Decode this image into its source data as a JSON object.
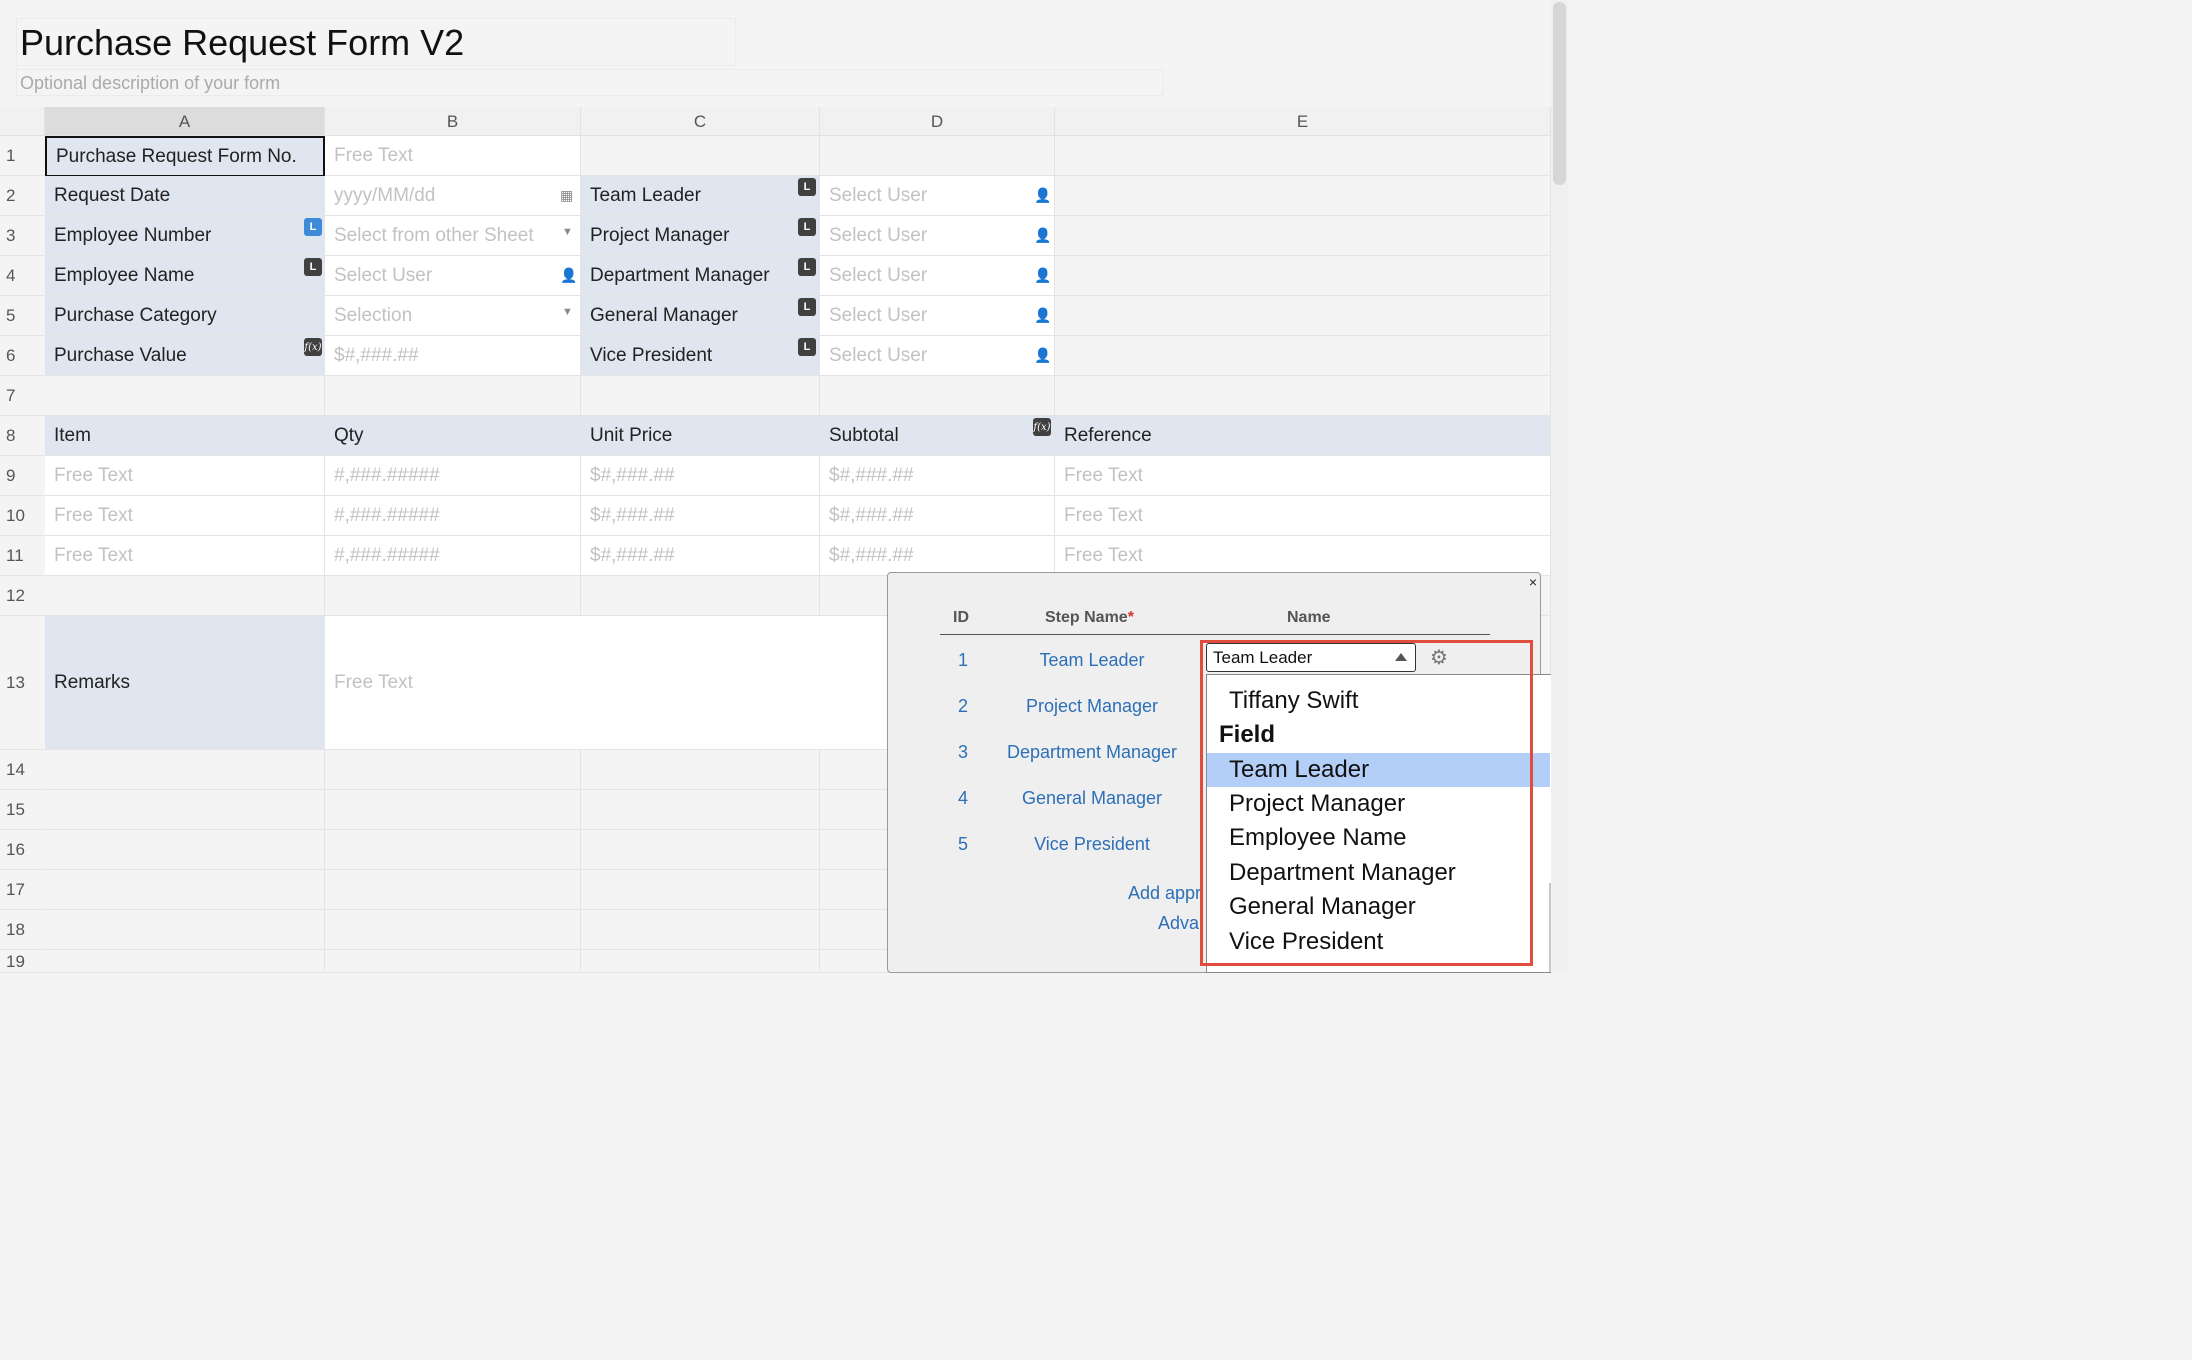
{
  "form": {
    "title": "Purchase Request Form V2",
    "description": "Optional description of your form"
  },
  "columns": [
    "A",
    "B",
    "C",
    "D",
    "E"
  ],
  "rows": [
    "1",
    "2",
    "3",
    "4",
    "5",
    "6",
    "7",
    "8",
    "9",
    "10",
    "11",
    "12",
    "13",
    "14",
    "15",
    "16",
    "17",
    "18",
    "19"
  ],
  "cells": {
    "r1": {
      "a": "Purchase Request Form No.",
      "b": "Free Text"
    },
    "r2": {
      "a": "Request Date",
      "b": "yyyy/MM/dd",
      "c": "Team Leader",
      "d": "Select User"
    },
    "r3": {
      "a": "Employee Number",
      "b": "Select from other Sheet",
      "c": "Project Manager",
      "d": "Select User"
    },
    "r4": {
      "a": "Employee Name",
      "b": "Select User",
      "c": "Department Manager",
      "d": "Select User"
    },
    "r5": {
      "a": "Purchase Category",
      "b": "Selection",
      "c": "General Manager",
      "d": "Select User"
    },
    "r6": {
      "a": "Purchase Value",
      "b": "$#,###.##",
      "c": "Vice President",
      "d": "Select User"
    },
    "r8": {
      "a": "Item",
      "b": "Qty",
      "c": "Unit Price",
      "d": "Subtotal",
      "e": "Reference"
    },
    "r9": {
      "a": "Free Text",
      "b": "#,###.#####",
      "c": "$#,###.##",
      "d": "$#,###.##",
      "e": "Free Text"
    },
    "r10": {
      "a": "Free Text",
      "b": "#,###.#####",
      "c": "$#,###.##",
      "d": "$#,###.##",
      "e": "Free Text"
    },
    "r11": {
      "a": "Free Text",
      "b": "#,###.#####",
      "c": "$#,###.##",
      "d": "$#,###.##",
      "e": "Free Text"
    },
    "r13": {
      "a": "Remarks",
      "b": "Free Text"
    }
  },
  "badges": {
    "lookup": "L",
    "formula": "f(x)"
  },
  "icons": {
    "calendar": "calendar-icon",
    "user": "user-icon",
    "caret": "caret-down-icon",
    "gear": "gear-icon",
    "close": "close-icon"
  },
  "panel": {
    "close": "×",
    "headers": {
      "id": "ID",
      "step": "Step Name",
      "required": "*",
      "name": "Name"
    },
    "steps": [
      {
        "id": "1",
        "name": "Team Leader"
      },
      {
        "id": "2",
        "name": "Project Manager"
      },
      {
        "id": "3",
        "name": "Department Manager"
      },
      {
        "id": "4",
        "name": "General Manager"
      },
      {
        "id": "5",
        "name": "Vice President"
      }
    ],
    "add_link": "Add appr",
    "adv_link": "Adva",
    "name_select": {
      "value": "Team Leader"
    },
    "dropdown": {
      "user_option": "Tiffany Swift",
      "group_label": "Field",
      "options": [
        "Team Leader",
        "Project Manager",
        "Employee Name",
        "Department Manager",
        "General Manager",
        "Vice President"
      ],
      "highlighted_index": 0
    }
  },
  "colors": {
    "label_bg": "#e0e6ef",
    "link": "#2d6fb7",
    "highlight_box": "#e14c3c",
    "option_highlight": "#b3cff7",
    "lookup_badge_blue": "#3d8ad9"
  }
}
